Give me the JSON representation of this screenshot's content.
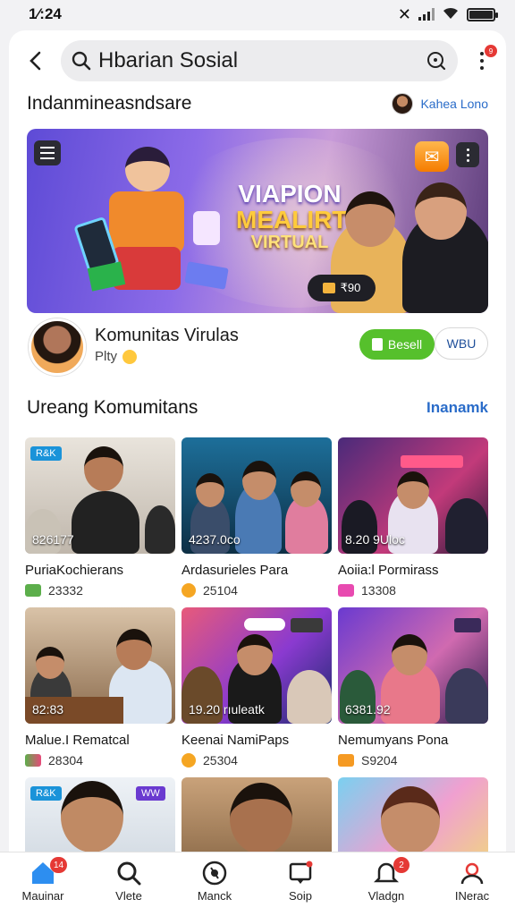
{
  "status_bar": {
    "time": "1⁄:24"
  },
  "header": {
    "search_text": "Hbarian Sosial",
    "notif_count": "9"
  },
  "section_top": {
    "title": "Indanmineasndsare",
    "user_name": "Kahea Lono"
  },
  "banner": {
    "title_line1": "VIAPION",
    "title_line2": "MEALIRT",
    "title_line3": "VIRTUAL",
    "pill_text": "₹90"
  },
  "community": {
    "name": "Komunitas Virulas",
    "subtitle": "Plty",
    "join_label": "Besell",
    "second_label": "WBU"
  },
  "section_grid": {
    "title": "Ureang Komumitans",
    "link": "Inanamk"
  },
  "tiles": [
    {
      "tag": "R&K",
      "count": "826177",
      "title": "PuriaKochierans",
      "stat": "23332"
    },
    {
      "tag": "",
      "count": "4237.0co",
      "title": "Ardasurieles Para",
      "stat": "25104"
    },
    {
      "tag": "",
      "count": "8.20 9Uloc",
      "title": "Aoiia:l Pormirass",
      "stat": "13308"
    },
    {
      "tag": "",
      "count": "82:83",
      "title": "Malue.I Rematcal",
      "stat": "28304"
    },
    {
      "tag": "",
      "count": "19.20 rıuleatk",
      "title": "Keenai NamiPaps",
      "stat": "25304"
    },
    {
      "tag": "",
      "count": "6381.92",
      "title": "Nemumyans Pona",
      "stat": "S9204"
    },
    {
      "tag": "R&K",
      "count": "",
      "title": "",
      "stat": ""
    },
    {
      "tag": "",
      "count": "",
      "title": "",
      "stat": ""
    },
    {
      "tag": "",
      "count": "",
      "title": "",
      "stat": ""
    }
  ],
  "tile_extra": {
    "tag_b": "WW"
  },
  "nav": [
    {
      "label": "Mauinar",
      "badge": "14"
    },
    {
      "label": "Vlete",
      "badge": ""
    },
    {
      "label": "Manck",
      "badge": ""
    },
    {
      "label": "Soip",
      "badge": ""
    },
    {
      "label": "Vladgn",
      "badge": "2"
    },
    {
      "label": "INerac",
      "badge": ""
    }
  ],
  "colors": {
    "accent_link": "#2a6cc9",
    "join_green": "#56c02c",
    "badge_red": "#e53935"
  }
}
